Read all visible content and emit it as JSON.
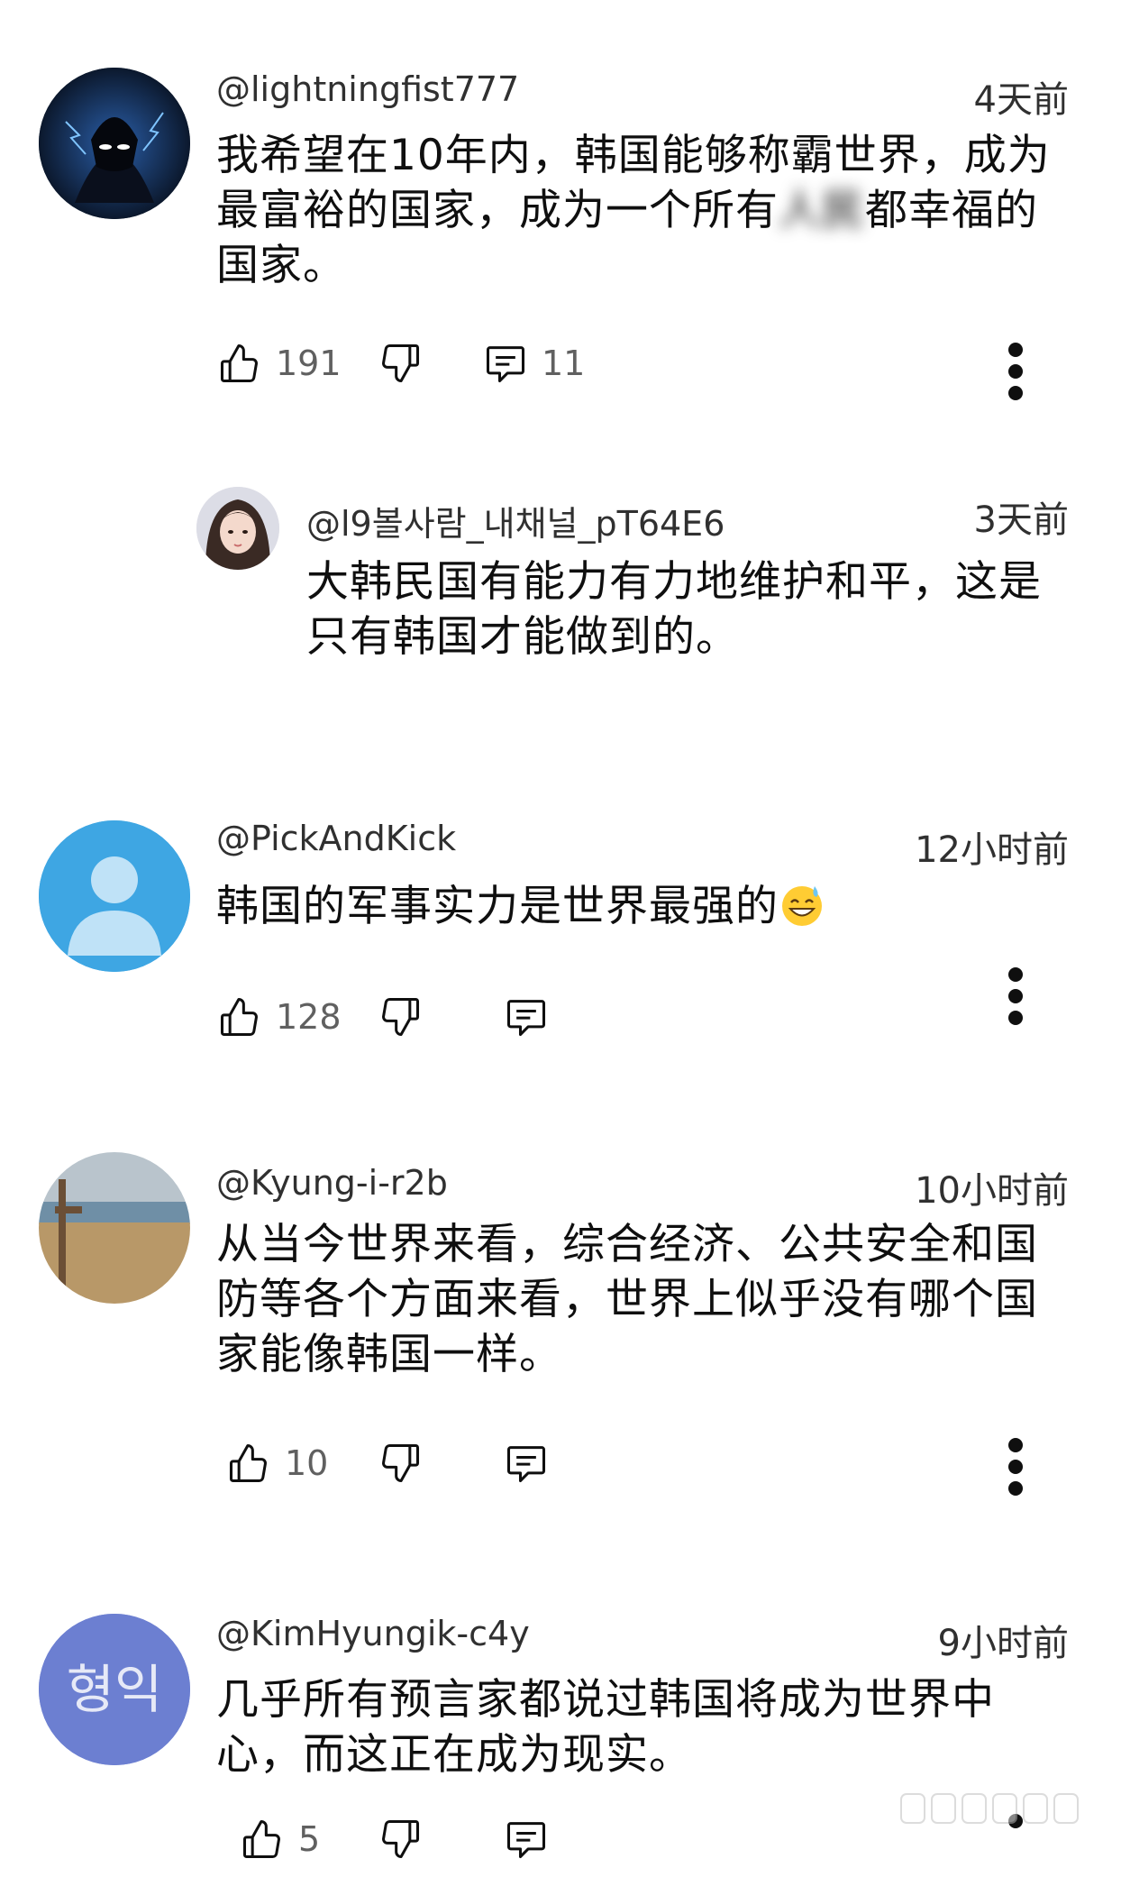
{
  "comments": [
    {
      "handle": "@lightningfist777",
      "time": "4天前",
      "line1": "我希望在10年内，韩国能够称霸世界，成为",
      "line2a": "最富裕的国家，成为一个所有",
      "line2_blur": "人民",
      "line2b": "都幸福的",
      "line3": "国家。",
      "likes": "191",
      "replies": "11"
    },
    {
      "handle": "@l9볼사람_내채널_pT64E6",
      "time": "3天前",
      "line1": "大韩民国有能力有力地维护和平，这是",
      "line2": "只有韩国才能做到的。"
    },
    {
      "handle": "@PickAndKick",
      "time": "12小时前",
      "line1": "韩国的军事实力是世界最强的",
      "likes": "128"
    },
    {
      "handle": "@Kyung-i-r2b",
      "time": "10小时前",
      "line1": "从当今世界来看，综合经济、公共安全和国",
      "line2": "防等各个方面来看，世界上似乎没有哪个国",
      "line3": "家能像韩国一样。",
      "likes": "10"
    },
    {
      "handle": "@KimHyungik-c4y",
      "time": "9小时前",
      "line1": "几乎所有预言家都说过韩国将成为世界中",
      "line2": "心，而这正在成为现实。",
      "likes": "5",
      "avatar_text": "형익"
    }
  ],
  "colors": {
    "text": "#0f0f0f",
    "meta": "#606060",
    "avatar_blue": "#3ea6e3",
    "avatar_purple": "#6c7fd1"
  },
  "icons": [
    "thumb-up-icon",
    "thumb-down-icon",
    "reply-icon",
    "more-vert-icon",
    "grinning-sweat-emoji"
  ]
}
